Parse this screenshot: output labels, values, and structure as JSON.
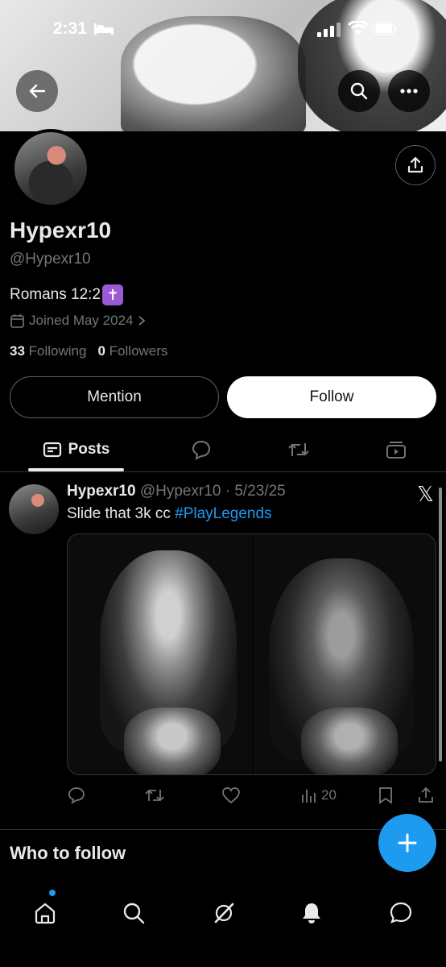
{
  "status_bar": {
    "time": "2:31"
  },
  "profile": {
    "name": "Hypexr10",
    "handle": "@Hypexr10",
    "bio": "Romans 12:2",
    "bio_emoji": "✝",
    "joined": "Joined May 2024",
    "following_count": "33",
    "following_label": "Following",
    "followers_count": "0",
    "followers_label": "Followers"
  },
  "actions": {
    "mention_label": "Mention",
    "follow_label": "Follow"
  },
  "tabs": {
    "posts_label": "Posts"
  },
  "post": {
    "author": "Hypexr10",
    "handle": "@Hypexr10",
    "separator": "·",
    "date": "5/23/25",
    "text": "Slide that 3k cc ",
    "hashtag": "#PlayLegends",
    "views": "20"
  },
  "who_to_follow": {
    "title": "Who to follow"
  },
  "colors": {
    "accent": "#1d9bf0",
    "background": "#000000",
    "muted": "#71767b",
    "text": "#e7e9ea"
  }
}
